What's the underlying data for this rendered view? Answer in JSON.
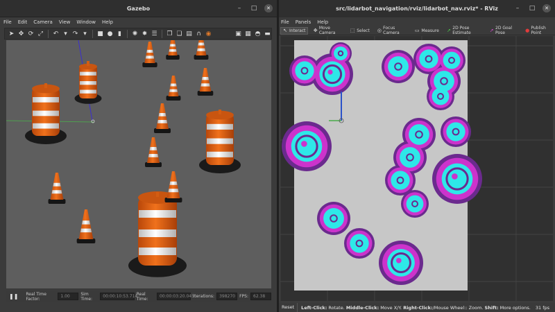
{
  "gazebo": {
    "title": "Gazebo",
    "menu": [
      "File",
      "Edit",
      "Camera",
      "View",
      "Window",
      "Help"
    ],
    "status": {
      "real_time_factor_label": "Real Time Factor:",
      "real_time_factor": "1.00",
      "sim_time_label": "Sim Time:",
      "sim_time": "00:00:10:53.714",
      "real_time_label": "Real Time:",
      "real_time": "00:00:03:20.045",
      "iterations_label": "Iterations:",
      "iterations": "398270",
      "fps_label": "FPS:",
      "fps": "62.38"
    }
  },
  "rviz": {
    "title": "src/lidarbot_navigation/rviz/lidarbot_nav.rviz* - RViz",
    "menu": [
      "File",
      "Panels",
      "Help"
    ],
    "tools": [
      {
        "label": "Interact",
        "icon": "cursor-icon"
      },
      {
        "label": "Move Camera",
        "icon": "move-camera-icon"
      },
      {
        "label": "Select",
        "icon": "select-icon"
      },
      {
        "label": "Focus Camera",
        "icon": "focus-camera-icon"
      },
      {
        "label": "Measure",
        "icon": "measure-icon"
      },
      {
        "label": "2D Pose Estimate",
        "icon": "pose-estimate-icon"
      },
      {
        "label": "2D Goal Pose",
        "icon": "goal-pose-icon"
      },
      {
        "label": "Publish Point",
        "icon": "publish-point-icon"
      }
    ],
    "status": {
      "reset_label": "Reset",
      "hint_1_bold": "Left-Click:",
      "hint_1": " Rotate. ",
      "hint_2_bold": "Middle-Click:",
      "hint_2": " Move X/Y. ",
      "hint_3_bold": "Right-Click:",
      "hint_3": "/Mouse Wheel:: Zoom. ",
      "hint_4_bold": "Shift:",
      "hint_4": " More options.",
      "fps": "31 fps"
    }
  },
  "colors": {
    "costmap_free": "#c7c7c7",
    "costmap_cyan": "#2ee8e8",
    "costmap_purple": "#6b2a8e",
    "costmap_magenta": "#cc33cc",
    "cone_orange": "#e8620f",
    "cone_white": "#f2f2f2",
    "ground": "#5e5e5e"
  }
}
